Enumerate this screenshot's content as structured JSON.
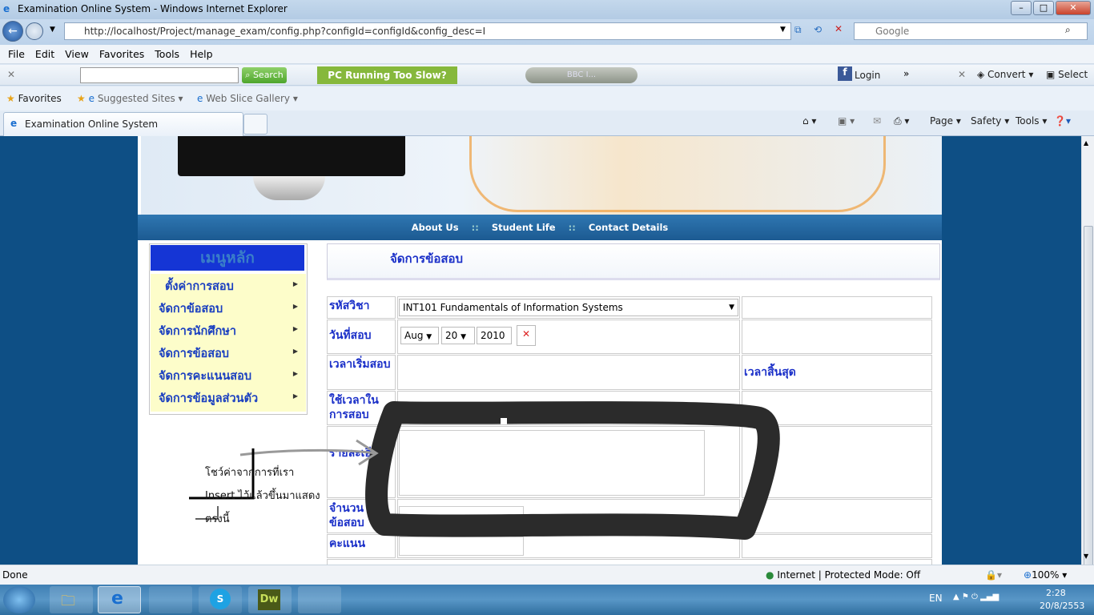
{
  "window": {
    "title": "Examination Online System - Windows Internet Explorer"
  },
  "address": {
    "url": "http://localhost/Project/manage_exam/config.php?configId=configId&config_desc=I",
    "search_placeholder": "Google"
  },
  "menubar": [
    "File",
    "Edit",
    "View",
    "Favorites",
    "Tools",
    "Help"
  ],
  "toolbar": {
    "search_label": "Search",
    "promo": "PC Running Too Slow?",
    "radio": "BBC I...",
    "login": "Login",
    "convert": "Convert",
    "select": "Select"
  },
  "favorites": {
    "favorites_label": "Favorites",
    "suggested": "Suggested Sites",
    "webslice": "Web Slice Gallery"
  },
  "tab": {
    "title": "Examination Online System"
  },
  "commandbar": [
    "Page",
    "Safety",
    "Tools"
  ],
  "site": {
    "nav": [
      "About Us",
      "Student Life",
      "Contact Details"
    ],
    "nav_sep": "::",
    "menu_title": "เมนูหลัก",
    "menu_items": [
      "ตั้งค่าการสอบ",
      "จัดกาข้อสอบ",
      "จัดการนักศึกษา",
      "จัดการข้อสอบ",
      "จัดการคะแนนสอบ",
      "จัดการข้อมูลส่วนตัว"
    ],
    "page_title": "จัดการข้อสอบ",
    "form": {
      "subject_label": "รหัสวิชา",
      "subject_value": "INT101 Fundamentals of Information Systems",
      "date_label": "วันที่สอบ",
      "month": "Aug",
      "day": "20",
      "year": "2010",
      "start_label": "เวลาเริ่มสอบ",
      "end_label": "เวลาสิ้นสุด",
      "duration_label": "ใช้เวลาในการสอบ",
      "detail_label": "รายละเอียด",
      "count_label": "จำนวนข้อสอบ",
      "score_label": "คะแนน"
    },
    "annotation": [
      "โชว์ค่าจากการที่เรา",
      "Insert ไว้แล้วขึ้นมาแสดง",
      "ตรงนี้"
    ]
  },
  "status": {
    "left": "Done",
    "zone": "Internet | Protected Mode: Off",
    "zoom": "100%"
  },
  "taskbar": {
    "lang": "EN",
    "time": "2:28",
    "date": "20/8/2553",
    "dw": "Dw"
  },
  "colors": {
    "label": "#1a2fc8",
    "menu_bg": "#fdfdca",
    "menu_title_bg": "#1535d5",
    "nav": "#1c5a92"
  }
}
